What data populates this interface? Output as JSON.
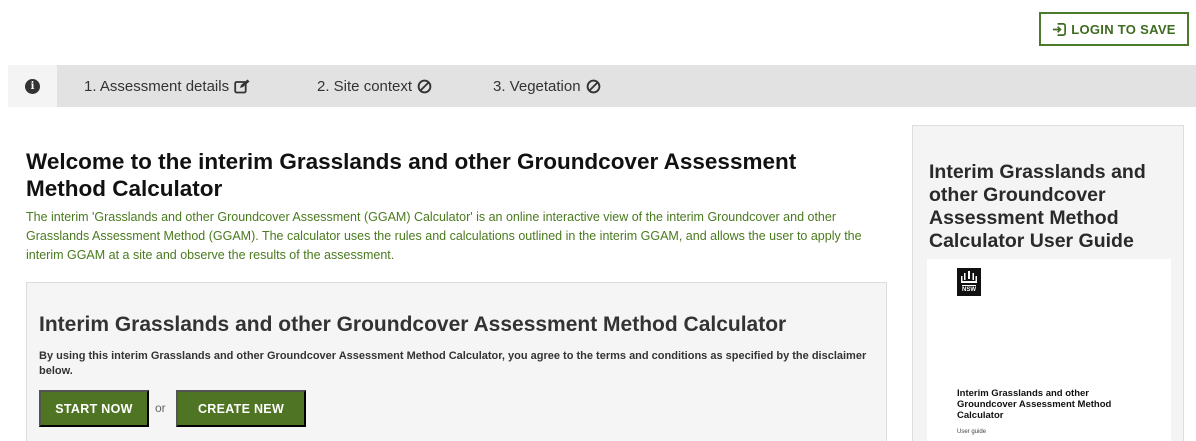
{
  "header": {
    "login_label": "LOGIN TO SAVE",
    "login_icon": "sign-in-icon"
  },
  "tabs": [
    {
      "label": "",
      "icon": "info-circle-icon"
    },
    {
      "label": "1. Assessment details",
      "icon": "edit-icon"
    },
    {
      "label": "2. Site context",
      "icon": "ban-icon"
    },
    {
      "label": "3. Vegetation",
      "icon": "ban-icon"
    }
  ],
  "main": {
    "title": "Welcome to the interim Grasslands and other Groundcover Assessment Method Calculator",
    "intro": "The interim 'Grasslands and other Groundcover Assessment (GGAM) Calculator' is an online interactive view of the interim Groundcover and other Grasslands Assessment Method (GGAM). The calculator uses the rules and calculations outlined in the interim GGAM, and allows the user to apply the interim GGAM at a site and observe the results of the assessment."
  },
  "panel": {
    "title": "Interim Grasslands and other Groundcover Assessment Method Calculator",
    "text": "By using this interim Grasslands and other Groundcover Assessment Method Calculator, you agree to the terms and conditions as specified by the disclaimer below.",
    "start_label": "START NOW",
    "or_label": "or",
    "create_label": "CREATE NEW"
  },
  "sidebar": {
    "title": "Interim Grasslands and other Groundcover Assessment Method Calculator User Guide",
    "cover_logo_text": "NSW",
    "cover_title": "Interim Grasslands and other Groundcover Assessment Method Calculator",
    "cover_subtitle": "User guide"
  },
  "colors": {
    "accent_green": "#4e7424",
    "intro_text_green": "#4a7a1e",
    "tab_bar": "#e2e2e2"
  }
}
